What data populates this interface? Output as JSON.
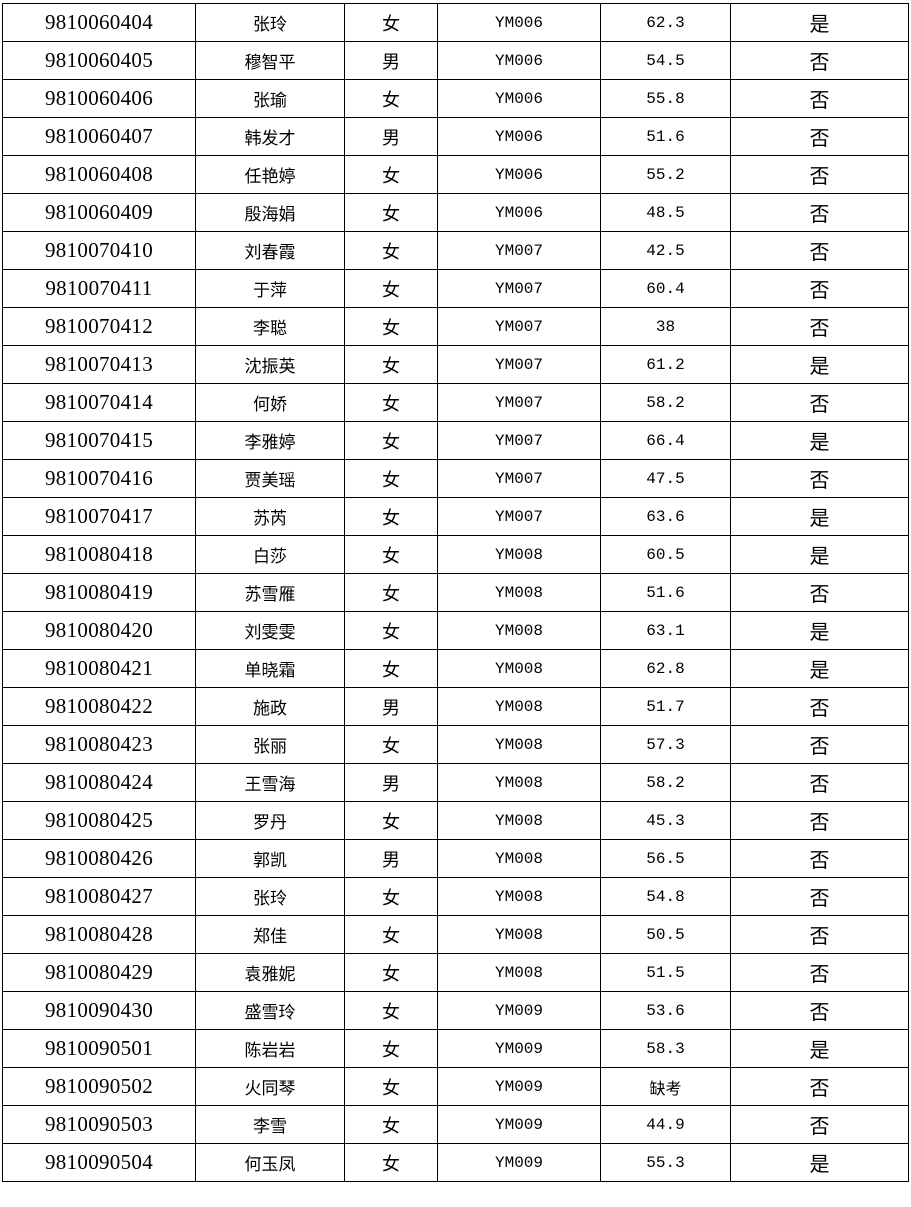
{
  "table": {
    "columns": [
      "exam_id",
      "name",
      "gender",
      "exam_room",
      "score",
      "qualified"
    ],
    "rows": [
      {
        "exam_id": "9810060404",
        "name": "张玲",
        "gender": "女",
        "exam_room": "YM006",
        "score": "62.3",
        "qualified": "是"
      },
      {
        "exam_id": "9810060405",
        "name": "穆智平",
        "gender": "男",
        "exam_room": "YM006",
        "score": "54.5",
        "qualified": "否"
      },
      {
        "exam_id": "9810060406",
        "name": "张瑜",
        "gender": "女",
        "exam_room": "YM006",
        "score": "55.8",
        "qualified": "否"
      },
      {
        "exam_id": "9810060407",
        "name": "韩发才",
        "gender": "男",
        "exam_room": "YM006",
        "score": "51.6",
        "qualified": "否"
      },
      {
        "exam_id": "9810060408",
        "name": "任艳婷",
        "gender": "女",
        "exam_room": "YM006",
        "score": "55.2",
        "qualified": "否"
      },
      {
        "exam_id": "9810060409",
        "name": "殷海娟",
        "gender": "女",
        "exam_room": "YM006",
        "score": "48.5",
        "qualified": "否"
      },
      {
        "exam_id": "9810070410",
        "name": "刘春霞",
        "gender": "女",
        "exam_room": "YM007",
        "score": "42.5",
        "qualified": "否"
      },
      {
        "exam_id": "9810070411",
        "name": "于萍",
        "gender": "女",
        "exam_room": "YM007",
        "score": "60.4",
        "qualified": "否"
      },
      {
        "exam_id": "9810070412",
        "name": "李聪",
        "gender": "女",
        "exam_room": "YM007",
        "score": "38",
        "qualified": "否"
      },
      {
        "exam_id": "9810070413",
        "name": "沈振英",
        "gender": "女",
        "exam_room": "YM007",
        "score": "61.2",
        "qualified": "是"
      },
      {
        "exam_id": "9810070414",
        "name": "何娇",
        "gender": "女",
        "exam_room": "YM007",
        "score": "58.2",
        "qualified": "否"
      },
      {
        "exam_id": "9810070415",
        "name": "李雅婷",
        "gender": "女",
        "exam_room": "YM007",
        "score": "66.4",
        "qualified": "是"
      },
      {
        "exam_id": "9810070416",
        "name": "贾美瑶",
        "gender": "女",
        "exam_room": "YM007",
        "score": "47.5",
        "qualified": "否"
      },
      {
        "exam_id": "9810070417",
        "name": "苏芮",
        "gender": "女",
        "exam_room": "YM007",
        "score": "63.6",
        "qualified": "是"
      },
      {
        "exam_id": "9810080418",
        "name": "白莎",
        "gender": "女",
        "exam_room": "YM008",
        "score": "60.5",
        "qualified": "是"
      },
      {
        "exam_id": "9810080419",
        "name": "苏雪雁",
        "gender": "女",
        "exam_room": "YM008",
        "score": "51.6",
        "qualified": "否"
      },
      {
        "exam_id": "9810080420",
        "name": "刘雯雯",
        "gender": "女",
        "exam_room": "YM008",
        "score": "63.1",
        "qualified": "是"
      },
      {
        "exam_id": "9810080421",
        "name": "单晓霜",
        "gender": "女",
        "exam_room": "YM008",
        "score": "62.8",
        "qualified": "是"
      },
      {
        "exam_id": "9810080422",
        "name": "施政",
        "gender": "男",
        "exam_room": "YM008",
        "score": "51.7",
        "qualified": "否"
      },
      {
        "exam_id": "9810080423",
        "name": "张丽",
        "gender": "女",
        "exam_room": "YM008",
        "score": "57.3",
        "qualified": "否"
      },
      {
        "exam_id": "9810080424",
        "name": "王雪海",
        "gender": "男",
        "exam_room": "YM008",
        "score": "58.2",
        "qualified": "否"
      },
      {
        "exam_id": "9810080425",
        "name": "罗丹",
        "gender": "女",
        "exam_room": "YM008",
        "score": "45.3",
        "qualified": "否"
      },
      {
        "exam_id": "9810080426",
        "name": "郭凯",
        "gender": "男",
        "exam_room": "YM008",
        "score": "56.5",
        "qualified": "否"
      },
      {
        "exam_id": "9810080427",
        "name": "张玲",
        "gender": "女",
        "exam_room": "YM008",
        "score": "54.8",
        "qualified": "否"
      },
      {
        "exam_id": "9810080428",
        "name": "郑佳",
        "gender": "女",
        "exam_room": "YM008",
        "score": "50.5",
        "qualified": "否"
      },
      {
        "exam_id": "9810080429",
        "name": "袁雅妮",
        "gender": "女",
        "exam_room": "YM008",
        "score": "51.5",
        "qualified": "否"
      },
      {
        "exam_id": "9810090430",
        "name": "盛雪玲",
        "gender": "女",
        "exam_room": "YM009",
        "score": "53.6",
        "qualified": "否"
      },
      {
        "exam_id": "9810090501",
        "name": "陈岩岩",
        "gender": "女",
        "exam_room": "YM009",
        "score": "58.3",
        "qualified": "是"
      },
      {
        "exam_id": "9810090502",
        "name": "火同琴",
        "gender": "女",
        "exam_room": "YM009",
        "score": "缺考",
        "qualified": "否"
      },
      {
        "exam_id": "9810090503",
        "name": "李雪",
        "gender": "女",
        "exam_room": "YM009",
        "score": "44.9",
        "qualified": "否"
      },
      {
        "exam_id": "9810090504",
        "name": "何玉凤",
        "gender": "女",
        "exam_room": "YM009",
        "score": "55.3",
        "qualified": "是"
      }
    ]
  }
}
